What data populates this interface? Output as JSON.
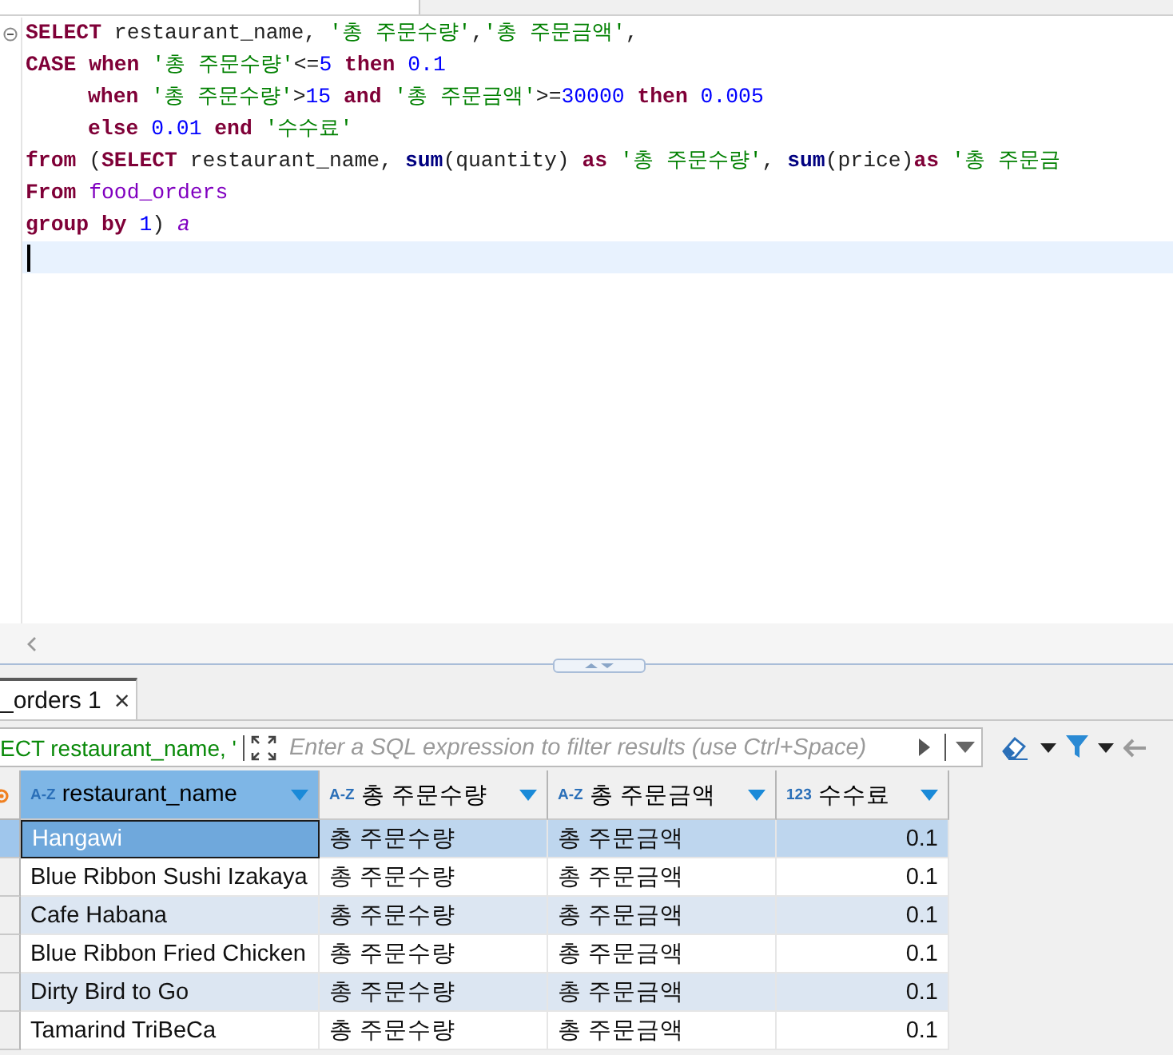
{
  "editor": {
    "lines": [
      {
        "foldable": true,
        "indented": false,
        "current": false,
        "tokens": [
          {
            "kind": "keyword",
            "t": "SELECT "
          },
          {
            "kind": "plain",
            "t": "restaurant_name, "
          },
          {
            "kind": "string",
            "t": "'총 주문수량'"
          },
          {
            "kind": "plain",
            "t": ","
          },
          {
            "kind": "string",
            "t": "'총 주문금액'"
          },
          {
            "kind": "plain",
            "t": ","
          }
        ]
      },
      {
        "foldable": false,
        "indented": false,
        "current": false,
        "tokens": [
          {
            "kind": "keyword",
            "t": "CASE when "
          },
          {
            "kind": "string",
            "t": "'총 주문수량'"
          },
          {
            "kind": "plain",
            "t": "<="
          },
          {
            "kind": "number",
            "t": "5"
          },
          {
            "kind": "keyword",
            "t": " then "
          },
          {
            "kind": "number",
            "t": "0.1"
          }
        ]
      },
      {
        "foldable": false,
        "indented": true,
        "current": false,
        "tokens": [
          {
            "kind": "keyword",
            "t": "when "
          },
          {
            "kind": "string",
            "t": "'총 주문수량'"
          },
          {
            "kind": "plain",
            "t": ">"
          },
          {
            "kind": "number",
            "t": "15"
          },
          {
            "kind": "keyword",
            "t": " and "
          },
          {
            "kind": "string",
            "t": "'총 주문금액'"
          },
          {
            "kind": "plain",
            "t": ">="
          },
          {
            "kind": "number",
            "t": "30000"
          },
          {
            "kind": "keyword",
            "t": " then "
          },
          {
            "kind": "number",
            "t": "0.005"
          }
        ]
      },
      {
        "foldable": false,
        "indented": true,
        "current": false,
        "tokens": [
          {
            "kind": "keyword",
            "t": "else "
          },
          {
            "kind": "number",
            "t": "0.01"
          },
          {
            "kind": "keyword",
            "t": " end "
          },
          {
            "kind": "string",
            "t": "'수수료'"
          }
        ]
      },
      {
        "foldable": false,
        "indented": false,
        "current": false,
        "tokens": [
          {
            "kind": "keyword",
            "t": "from"
          },
          {
            "kind": "plain",
            "t": " ("
          },
          {
            "kind": "keyword",
            "t": "SELECT "
          },
          {
            "kind": "plain",
            "t": "restaurant_name, "
          },
          {
            "kind": "function",
            "t": "sum"
          },
          {
            "kind": "plain",
            "t": "(quantity) "
          },
          {
            "kind": "keyword",
            "t": "as "
          },
          {
            "kind": "string",
            "t": "'총 주문수량'"
          },
          {
            "kind": "plain",
            "t": ", "
          },
          {
            "kind": "function",
            "t": "sum"
          },
          {
            "kind": "plain",
            "t": "(price)"
          },
          {
            "kind": "keyword",
            "t": "as "
          },
          {
            "kind": "string",
            "t": "'총 주문금"
          }
        ]
      },
      {
        "foldable": false,
        "indented": false,
        "current": false,
        "tokens": [
          {
            "kind": "keyword",
            "t": "From "
          },
          {
            "kind": "table",
            "t": "food_orders"
          }
        ]
      },
      {
        "foldable": false,
        "indented": false,
        "current": false,
        "tokens": [
          {
            "kind": "keyword",
            "t": "group by "
          },
          {
            "kind": "number",
            "t": "1"
          },
          {
            "kind": "plain",
            "t": ") "
          },
          {
            "kind": "alias",
            "t": "a"
          }
        ]
      },
      {
        "foldable": false,
        "indented": false,
        "current": true
      }
    ]
  },
  "results": {
    "tab": {
      "label": "_orders 1",
      "close": "×"
    },
    "filter": {
      "query": "ECT restaurant_name, '",
      "placeholder": "Enter a SQL expression to filter results (use Ctrl+Space)"
    },
    "columns": [
      {
        "type_label": "A-Z",
        "label": "restaurant_name",
        "selected": true,
        "kind": "text"
      },
      {
        "type_label": "A-Z",
        "label": "총 주문수량",
        "selected": false,
        "kind": "text"
      },
      {
        "type_label": "A-Z",
        "label": "총 주문금액",
        "selected": false,
        "kind": "text"
      },
      {
        "type_label": "123",
        "label": "수수료",
        "selected": false,
        "kind": "number"
      }
    ],
    "rows": [
      {
        "selected": true,
        "cells": [
          "Hangawi",
          "총 주문수량",
          "총 주문금액",
          "0.1"
        ]
      },
      {
        "selected": false,
        "cells": [
          "Blue Ribbon Sushi Izakaya",
          "총 주문수량",
          "총 주문금액",
          "0.1"
        ]
      },
      {
        "selected": false,
        "cells": [
          "Cafe Habana",
          "총 주문수량",
          "총 주문금액",
          "0.1"
        ]
      },
      {
        "selected": false,
        "cells": [
          "Blue Ribbon Fried Chicken",
          "총 주문수량",
          "총 주문금액",
          "0.1"
        ]
      },
      {
        "selected": false,
        "cells": [
          "Dirty Bird to Go",
          "총 주문수량",
          "총 주문금액",
          "0.1"
        ]
      },
      {
        "selected": false,
        "cells": [
          "Tamarind TriBeCa",
          "총 주문수량",
          "총 주문금액",
          "0.1"
        ]
      }
    ]
  }
}
